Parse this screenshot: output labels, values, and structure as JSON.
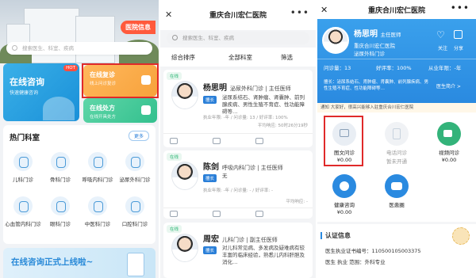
{
  "panel1": {
    "info_badge": "医院信息",
    "search_placeholder": "搜索医生、科室、疾病",
    "online_consult": {
      "title": "在线咨询",
      "subtitle": "快速健康咨询",
      "hot": "HOT"
    },
    "online_return": {
      "title": "在线复诊",
      "subtitle": "线上问诊复诊"
    },
    "online_rx": {
      "title": "在线处方",
      "subtitle": "在线开具处方"
    },
    "dept_title": "热门科室",
    "more": "更多",
    "depts": [
      "儿科门诊",
      "骨科门诊",
      "呼吸内科门诊",
      "泌尿外科门诊",
      "心血管内科门诊",
      "眼科门诊",
      "中医科门诊",
      "口腔科门诊"
    ],
    "banner": "在线咨询正式上线啦~"
  },
  "panel2": {
    "title": "重庆合川宏仁医院",
    "close": "✕",
    "more": "•••",
    "search_placeholder": "搜索医生、科室、疾病",
    "filters": [
      "综合排序",
      "全部科室",
      "筛选"
    ],
    "doctors": [
      {
        "status": "在线",
        "name": "杨思明",
        "title": "泌尿外科门诊 | 主任医师",
        "tag": "擅长",
        "desc": "泌尿系结石、肾肿瘤、肾囊肿、前列腺疾病、男性生殖不育症、性功能障碍等…",
        "meta": "执业年限: -年 / 问诊量: 13 / 好评率: 100%",
        "resp": "平均响应: 50时26分19秒"
      },
      {
        "status": "在线",
        "name": "陈剑",
        "title": "呼吸内科门诊 | 主任医师",
        "tag": "擅长",
        "desc": "无",
        "meta": "执业年限: -年 / 问诊量: - / 好评率: -",
        "resp": "平均响应: -"
      },
      {
        "status": "在线",
        "name": "周宏",
        "title": "儿科门诊 | 副主任医师",
        "tag": "擅长",
        "desc": "对儿科常见病、多发病及疑难病有较丰富的临床经验，熟悉儿内科肝胆及消化…",
        "meta": "",
        "resp": ""
      }
    ]
  },
  "panel3": {
    "title": "重庆合川宏仁医院",
    "close": "✕",
    "more": "•••",
    "doctor_name": "杨思明",
    "doctor_title": "主任医师",
    "hospital": "重庆合川宏仁医院",
    "dept": "泌尿外科门诊",
    "follow": "关注",
    "share": "分享",
    "stats": {
      "consult": "问诊量：13",
      "rate": "好评率：100%",
      "years": "从业年限：-年"
    },
    "skill": "擅长：泌尿系结石、肾肿瘤、肾囊肿、前列腺疾病、男性生殖不育症、性功能障碍等…",
    "intro_link": "医生简介 >",
    "notice": "通知  大家好，很高兴能够入驻重庆合川宏仁医院",
    "services": [
      {
        "label": "图文问诊",
        "price": "¥0.00",
        "color": "#8aa0b8"
      },
      {
        "label": "电话问诊",
        "price": "暂未开通",
        "color": "#c8d3de"
      },
      {
        "label": "视频问诊",
        "price": "¥0.00",
        "color": "#33b37a"
      },
      {
        "label": "健康咨询",
        "price": "¥0.00",
        "color": "#2a8ae0"
      },
      {
        "label": "医患圈",
        "price": "",
        "color": "#2a8ae0"
      }
    ],
    "cert_title": "认证信息",
    "cert_no": "医生执业证书编号：110500105003375",
    "cert_scope": "医生 执业 范围：外科专业"
  }
}
